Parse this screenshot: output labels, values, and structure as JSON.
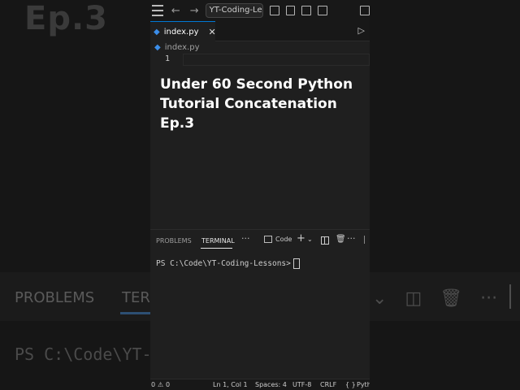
{
  "background": {
    "title": "Ep.3",
    "problems_label": "PROBLEMS",
    "terminal_label": "TERM",
    "prompt": "PS C:\\Code\\YT-"
  },
  "window": {
    "search_text": "YT-Coding-Lessons",
    "tab_label": "index.py",
    "breadcrumb_file": "index.py",
    "line_number": "1",
    "overlay_lines": [
      "Under 60 Second Python",
      "Tutorial Concatenation",
      "Ep.3"
    ],
    "panel": {
      "problems_label": "PROBLEMS",
      "terminal_label": "TERMINAL",
      "more": "···",
      "terminal_name": "Code",
      "add": "+",
      "more2": "···"
    },
    "terminal_prompt": "PS C:\\Code\\YT-Coding-Lessons>",
    "status": {
      "errors": "0",
      "warnings": "0",
      "position": "Ln 1, Col 1",
      "spaces": "Spaces: 4",
      "encoding": "UTF-8",
      "eol": "CRLF",
      "braces": "{ }",
      "language": "Pyth"
    }
  },
  "colors": {
    "accent": "#0078d4",
    "python_icon": "#3b8eea",
    "editor_bg": "#1f1f1f"
  }
}
